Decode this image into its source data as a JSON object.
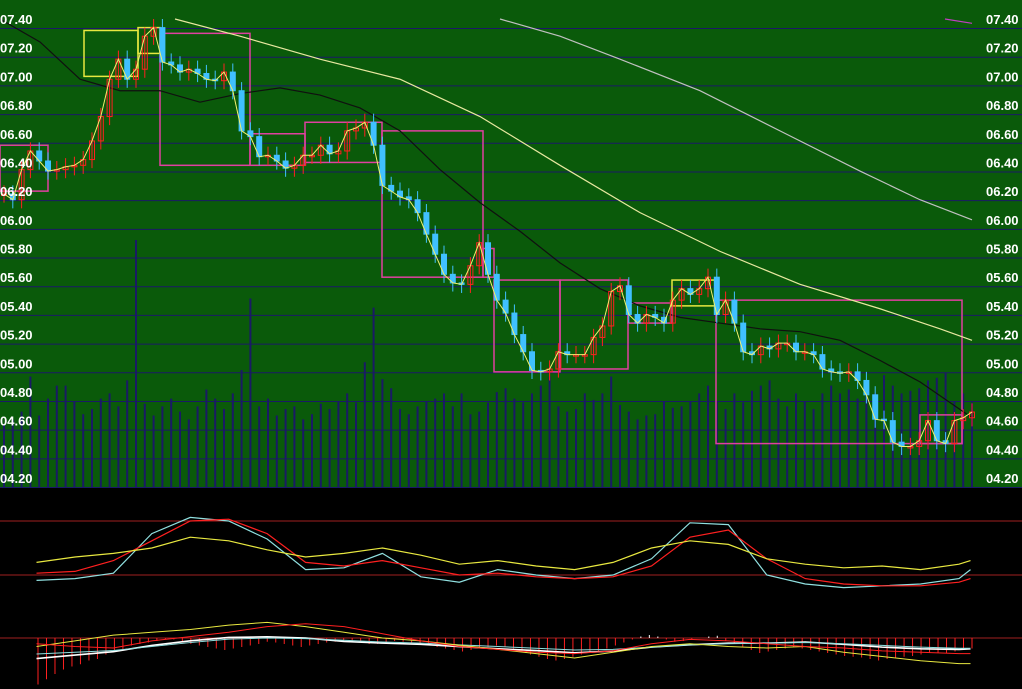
{
  "colors": {
    "price_panel_bg": "#0a5a0a",
    "indicator_bg": "#000000",
    "grid_line": "#1a1a66",
    "tick_text": "#ffffff",
    "volume_bar": "#1a1a66",
    "candle_up": "#ff2020",
    "candle_down": "#40c0ff",
    "close_line": "#f0f070",
    "ma_dark": "#101010",
    "ma_light": "#c0c0c0",
    "ma_pale": "#e8e8a0",
    "box_magenta": "#e040a0",
    "box_yellow": "#e8e840",
    "ind_white": "#ffffff",
    "ind_red": "#ff2020",
    "ind_yellow": "#e8e840",
    "ind_cyan": "#90e0e0",
    "ind_hline": "#a02020"
  },
  "chart_data": [
    {
      "type": "candlestick",
      "panel": "price",
      "title": "",
      "xlabel": "",
      "ylabel": "",
      "grid": true,
      "ylim": [
        4.2,
        7.4
      ],
      "y_ticks": [
        "07.40",
        "07.20",
        "07.00",
        "06.80",
        "06.60",
        "06.40",
        "06.20",
        "06.00",
        "05.80",
        "05.60",
        "05.40",
        "05.20",
        "05.00",
        "04.80",
        "04.60",
        "04.40",
        "04.20"
      ],
      "y_tick_values": [
        7.4,
        7.2,
        7.0,
        6.8,
        6.6,
        6.4,
        6.2,
        6.0,
        5.8,
        5.6,
        5.4,
        5.2,
        5.0,
        4.8,
        4.6,
        4.4,
        4.2
      ],
      "axis_labels_both_sides": true,
      "closes": [
        6.18,
        6.14,
        6.35,
        6.48,
        6.41,
        6.34,
        6.35,
        6.37,
        6.38,
        6.42,
        6.55,
        6.72,
        6.98,
        7.12,
        6.98,
        7.05,
        7.28,
        7.34,
        7.1,
        7.08,
        7.03,
        7.05,
        7.02,
        6.98,
        6.97,
        7.03,
        6.9,
        6.62,
        6.58,
        6.44,
        6.45,
        6.41,
        6.36,
        6.38,
        6.45,
        6.45,
        6.52,
        6.46,
        6.48,
        6.62,
        6.64,
        6.68,
        6.52,
        6.24,
        6.2,
        6.16,
        6.14,
        6.05,
        5.9,
        5.76,
        5.62,
        5.56,
        5.55,
        5.68,
        5.84,
        5.62,
        5.44,
        5.35,
        5.2,
        5.08,
        4.95,
        4.94,
        4.96,
        5.08,
        5.06,
        5.06,
        5.06,
        5.18,
        5.26,
        5.5,
        5.54,
        5.34,
        5.28,
        5.34,
        5.32,
        5.28,
        5.44,
        5.52,
        5.48,
        5.52,
        5.6,
        5.34,
        5.44,
        5.28,
        5.08,
        5.06,
        5.12,
        5.1,
        5.14,
        5.14,
        5.08,
        5.08,
        5.06,
        4.96,
        4.94,
        4.93,
        4.94,
        4.88,
        4.78,
        4.61,
        4.6,
        4.45,
        4.42,
        4.42,
        4.46,
        4.6,
        4.46,
        4.44,
        4.6,
        4.62,
        4.66
      ],
      "volume": [
        0.48,
        0.52,
        0.58,
        0.85,
        0.55,
        0.68,
        0.78,
        0.78,
        0.66,
        0.56,
        0.6,
        0.68,
        0.72,
        0.62,
        0.82,
        1.9,
        0.64,
        0.55,
        0.62,
        0.68,
        0.58,
        0.52,
        0.62,
        0.75,
        0.68,
        0.6,
        0.72,
        0.9,
        1.45,
        0.62,
        0.68,
        0.55,
        0.6,
        0.62,
        0.52,
        0.56,
        0.64,
        0.6,
        0.66,
        0.72,
        0.65,
        0.96,
        1.38,
        0.83,
        0.76,
        0.6,
        0.56,
        0.62,
        0.66,
        0.68,
        0.72,
        0.62,
        0.72,
        0.56,
        0.58,
        0.65,
        0.73,
        0.76,
        0.68,
        0.65,
        0.72,
        0.78,
        0.85,
        0.62,
        0.58,
        0.6,
        0.72,
        0.67,
        0.72,
        0.85,
        0.63,
        0.58,
        0.52,
        0.55,
        0.56,
        0.66,
        0.61,
        0.62,
        0.66,
        0.72,
        0.78,
        0.66,
        0.6,
        0.72,
        0.65,
        0.74,
        0.78,
        0.82,
        0.68,
        0.62,
        0.72,
        0.66,
        0.6,
        0.72,
        0.78,
        0.72,
        0.75,
        0.68,
        0.8,
        0.72,
        0.86,
        0.78,
        0.72,
        0.74,
        0.76,
        0.82,
        0.84,
        0.88,
        0.66,
        0.72,
        0.65
      ],
      "ma_dark": [
        [
          0,
          7.4
        ],
        [
          40,
          7.24
        ],
        [
          80,
          6.98
        ],
        [
          120,
          6.9
        ],
        [
          160,
          6.9
        ],
        [
          200,
          6.82
        ],
        [
          240,
          6.88
        ],
        [
          280,
          6.92
        ],
        [
          320,
          6.87
        ],
        [
          360,
          6.78
        ],
        [
          400,
          6.62
        ],
        [
          440,
          6.35
        ],
        [
          480,
          6.12
        ],
        [
          520,
          5.92
        ],
        [
          560,
          5.7
        ],
        [
          600,
          5.52
        ],
        [
          640,
          5.4
        ],
        [
          680,
          5.32
        ],
        [
          720,
          5.28
        ],
        [
          760,
          5.24
        ],
        [
          800,
          5.22
        ],
        [
          840,
          5.16
        ],
        [
          880,
          5.02
        ],
        [
          920,
          4.87
        ],
        [
          972,
          4.62
        ]
      ],
      "ma_light": [
        [
          500,
          7.4
        ],
        [
          560,
          7.28
        ],
        [
          620,
          7.12
        ],
        [
          700,
          6.9
        ],
        [
          780,
          6.62
        ],
        [
          860,
          6.34
        ],
        [
          920,
          6.14
        ],
        [
          972,
          6.0
        ]
      ],
      "ma_pale": [
        [
          175,
          7.4
        ],
        [
          240,
          7.28
        ],
        [
          320,
          7.12
        ],
        [
          400,
          6.98
        ],
        [
          480,
          6.72
        ],
        [
          560,
          6.38
        ],
        [
          640,
          6.05
        ],
        [
          720,
          5.78
        ],
        [
          800,
          5.55
        ],
        [
          880,
          5.38
        ],
        [
          940,
          5.24
        ],
        [
          972,
          5.16
        ]
      ],
      "ma_purple": [
        [
          945,
          7.4
        ],
        [
          972,
          7.37
        ]
      ],
      "boxes_magenta": [
        [
          0,
          6.2,
          48,
          6.52
        ],
        [
          160,
          6.38,
          250,
          7.3
        ],
        [
          250,
          6.38,
          305,
          6.6
        ],
        [
          305,
          6.4,
          382,
          6.68
        ],
        [
          382,
          5.6,
          483,
          6.62
        ],
        [
          483,
          5.6,
          494,
          5.8
        ],
        [
          494,
          4.94,
          560,
          5.58
        ],
        [
          560,
          4.96,
          628,
          5.58
        ],
        [
          628,
          5.28,
          672,
          5.42
        ],
        [
          716,
          4.44,
          962,
          5.44
        ],
        [
          920,
          4.44,
          962,
          4.64
        ]
      ],
      "boxes_yellow": [
        [
          84,
          7.0,
          138,
          7.32
        ],
        [
          138,
          7.16,
          160,
          7.34
        ],
        [
          672,
          5.4,
          716,
          5.58
        ]
      ]
    },
    {
      "type": "line",
      "panel": "oscillator",
      "title": "",
      "xlabel": "",
      "ylabel": "",
      "grid": false,
      "ylim": [
        0,
        100
      ],
      "hlines": [
        80,
        20
      ],
      "x": [
        0,
        40,
        80,
        120,
        160,
        200,
        240,
        280,
        320,
        360,
        400,
        440,
        480,
        520,
        560,
        600,
        640,
        680,
        720,
        760,
        800,
        840,
        880,
        920,
        960,
        972
      ],
      "series": [
        {
          "color_key": "ind_cyan",
          "values": [
            14,
            16,
            22,
            66,
            84,
            80,
            60,
            26,
            28,
            44,
            18,
            12,
            26,
            20,
            16,
            20,
            38,
            78,
            76,
            20,
            10,
            6,
            8,
            10,
            16,
            26
          ]
        },
        {
          "color_key": "ind_red",
          "values": [
            22,
            24,
            36,
            58,
            80,
            82,
            66,
            34,
            30,
            36,
            28,
            20,
            22,
            18,
            16,
            18,
            30,
            62,
            70,
            38,
            16,
            10,
            8,
            8,
            12,
            16
          ]
        },
        {
          "color_key": "ind_yellow",
          "values": [
            34,
            40,
            44,
            50,
            62,
            58,
            48,
            40,
            44,
            50,
            42,
            32,
            36,
            30,
            26,
            34,
            50,
            58,
            54,
            38,
            32,
            28,
            30,
            26,
            32,
            36
          ]
        }
      ]
    },
    {
      "type": "line",
      "panel": "macd",
      "title": "",
      "xlabel": "",
      "ylabel": "",
      "grid": false,
      "ylim": [
        -1,
        1
      ],
      "zero_line": true,
      "x": [
        0,
        40,
        80,
        120,
        160,
        200,
        240,
        280,
        320,
        360,
        400,
        440,
        480,
        520,
        560,
        600,
        640,
        680,
        720,
        760,
        800,
        840,
        880,
        920,
        960,
        972
      ],
      "series": [
        {
          "color_key": "ind_white",
          "values": [
            -0.72,
            -0.6,
            -0.48,
            -0.26,
            -0.1,
            0.02,
            0.04,
            0.0,
            -0.12,
            -0.18,
            -0.22,
            -0.3,
            -0.38,
            -0.44,
            -0.52,
            -0.46,
            -0.32,
            -0.24,
            -0.18,
            -0.18,
            -0.14,
            -0.22,
            -0.32,
            -0.38,
            -0.4,
            -0.38
          ]
        },
        {
          "color_key": "ind_cyan",
          "values": [
            -0.56,
            -0.5,
            -0.44,
            -0.3,
            -0.16,
            -0.04,
            0.0,
            -0.02,
            -0.08,
            -0.14,
            -0.18,
            -0.24,
            -0.3,
            -0.36,
            -0.42,
            -0.4,
            -0.32,
            -0.24,
            -0.2,
            -0.18,
            -0.16,
            -0.2,
            -0.26,
            -0.32,
            -0.36,
            -0.36
          ]
        },
        {
          "color_key": "ind_yellow",
          "values": [
            -0.3,
            -0.1,
            0.1,
            0.2,
            0.3,
            0.45,
            0.55,
            0.4,
            0.2,
            0.0,
            -0.1,
            -0.25,
            -0.4,
            -0.55,
            -0.7,
            -0.5,
            -0.3,
            -0.2,
            -0.3,
            -0.35,
            -0.3,
            -0.5,
            -0.65,
            -0.8,
            -0.9,
            -0.9
          ]
        },
        {
          "color_key": "ind_red",
          "values": [
            -0.2,
            -0.3,
            -0.35,
            -0.1,
            0.05,
            0.2,
            0.4,
            0.5,
            0.4,
            0.15,
            -0.1,
            -0.3,
            -0.4,
            -0.5,
            -0.55,
            -0.45,
            -0.2,
            -0.05,
            -0.1,
            -0.2,
            -0.3,
            -0.35,
            -0.45,
            -0.5,
            -0.55,
            -0.55
          ]
        }
      ],
      "histogram": [
        -0.62,
        -0.55,
        -0.48,
        -0.42,
        -0.38,
        -0.35,
        -0.3,
        -0.28,
        -0.22,
        -0.18,
        -0.15,
        -0.1,
        -0.08,
        -0.06,
        -0.04,
        -0.02,
        -0.02,
        -0.05,
        -0.08,
        -0.1,
        -0.12,
        -0.14,
        -0.16,
        -0.14,
        -0.12,
        -0.1,
        -0.08,
        -0.05,
        -0.06,
        -0.08,
        -0.1,
        -0.12,
        -0.1,
        -0.08,
        -0.06,
        -0.05,
        -0.04,
        -0.04,
        -0.06,
        -0.08,
        -0.08,
        -0.06,
        -0.04,
        -0.05,
        -0.06,
        -0.08,
        -0.1,
        -0.12,
        -0.14,
        -0.16,
        -0.18,
        -0.16,
        -0.14,
        -0.12,
        -0.1,
        -0.12,
        -0.14,
        -0.18,
        -0.22,
        -0.25,
        -0.28,
        -0.3,
        -0.28,
        -0.25,
        -0.22,
        -0.2,
        -0.18,
        -0.14,
        -0.1,
        -0.06,
        -0.02,
        0.02,
        0.04,
        0.02,
        -0.02,
        -0.05,
        -0.04,
        -0.02,
        0.0,
        0.02,
        0.03,
        -0.04,
        -0.08,
        -0.12,
        -0.16,
        -0.2,
        -0.18,
        -0.16,
        -0.14,
        -0.12,
        -0.14,
        -0.16,
        -0.18,
        -0.2,
        -0.22,
        -0.24,
        -0.25,
        -0.26,
        -0.28,
        -0.3,
        -0.28,
        -0.26,
        -0.25,
        -0.24,
        -0.22,
        -0.2,
        -0.2,
        -0.2,
        -0.18,
        -0.16,
        -0.14
      ]
    }
  ]
}
